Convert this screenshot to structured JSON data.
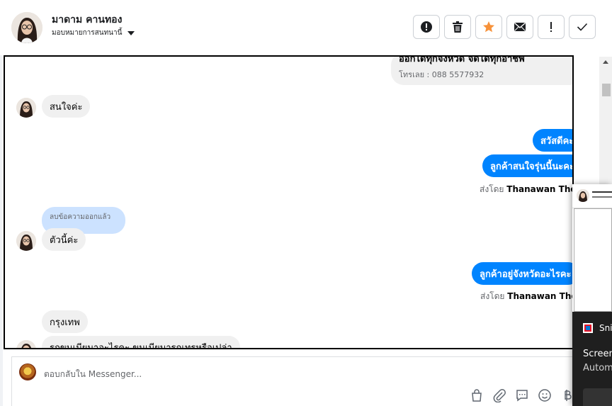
{
  "header": {
    "contact_name": "มาดาม คานทอง",
    "assign_label": "มอบหมายการสนทนานี้",
    "actions": [
      {
        "name": "spam-button",
        "icon": "alert-circle-icon"
      },
      {
        "name": "delete-button",
        "icon": "trash-icon"
      },
      {
        "name": "star-button",
        "icon": "star-icon"
      },
      {
        "name": "mark-unread-button",
        "icon": "envelope-icon"
      },
      {
        "name": "follow-up-button",
        "icon": "exclamation-icon"
      },
      {
        "name": "mark-done-button",
        "icon": "check-icon"
      }
    ]
  },
  "thread": {
    "promo": {
      "line1": "ออกได้ทุกจังหวัด จัดได้ทุกอาชีพ",
      "line2": "โทรเลย : 088 5577932"
    },
    "msg_interested": "สนใจค่ะ",
    "msg_hello": "สวัสดีคะ",
    "msg_which_model": "ลูกค้าสนใจรุ่นนี้นะคะ",
    "sent_by_prefix": "ส่งโดย",
    "sent_by_name": "Thanawan Thon",
    "deleted_label": "ลบข้อความออกแล้ว",
    "msg_this_one": "ตัวนี้ค่ะ",
    "msg_province": "ลูกค้าอยู่จังหวัดอะไรคะ",
    "sent_by_prefix_2": "ส่งโดย",
    "sent_by_name_2": "Thanawan Thon",
    "msg_bangkok": "กรุงเทพ",
    "msg_partial": "รถขนเมียมาอะไรคะ ขนเมียมารถเทรหรือเปล่า"
  },
  "composer": {
    "placeholder": "ตอบกลับใน Messenger..."
  },
  "snip": {
    "title": "Snip",
    "line1": "Screen",
    "line2": "Autom"
  },
  "colors": {
    "outgoing": "#0084ff",
    "incoming": "#f0f0f0",
    "star": "#f7923a"
  }
}
